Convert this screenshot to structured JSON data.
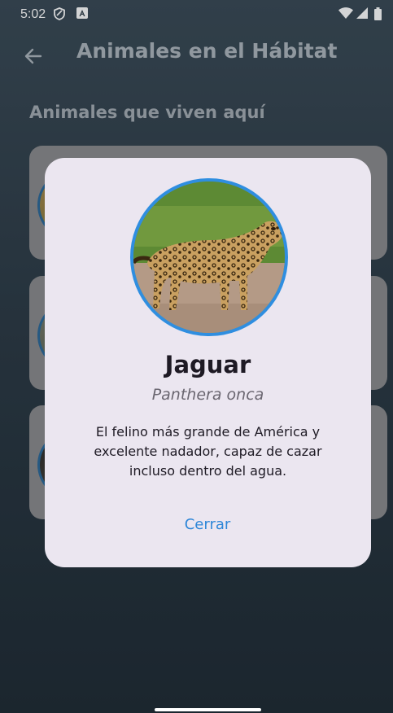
{
  "status_bar": {
    "time": "5:02",
    "icons": [
      "shield-icon",
      "accessibility-a-icon",
      "wifi-icon",
      "signal-icon",
      "battery-icon"
    ]
  },
  "app_bar": {
    "back_icon": "arrow-left-icon",
    "title": "Animales en el Hábitat"
  },
  "section": {
    "title": "Animales que viven aquí"
  },
  "dialog": {
    "name": "Jaguar",
    "scientific_name": "Panthera onca",
    "description": "El felino más grande de América y excelente nadador, capaz de cazar incluso dentro del agua.",
    "close_label": "Cerrar"
  },
  "colors": {
    "accent": "#2f8ee0",
    "dialog_bg": "#ebe6f0",
    "card_bg": "#8c8c8e"
  }
}
